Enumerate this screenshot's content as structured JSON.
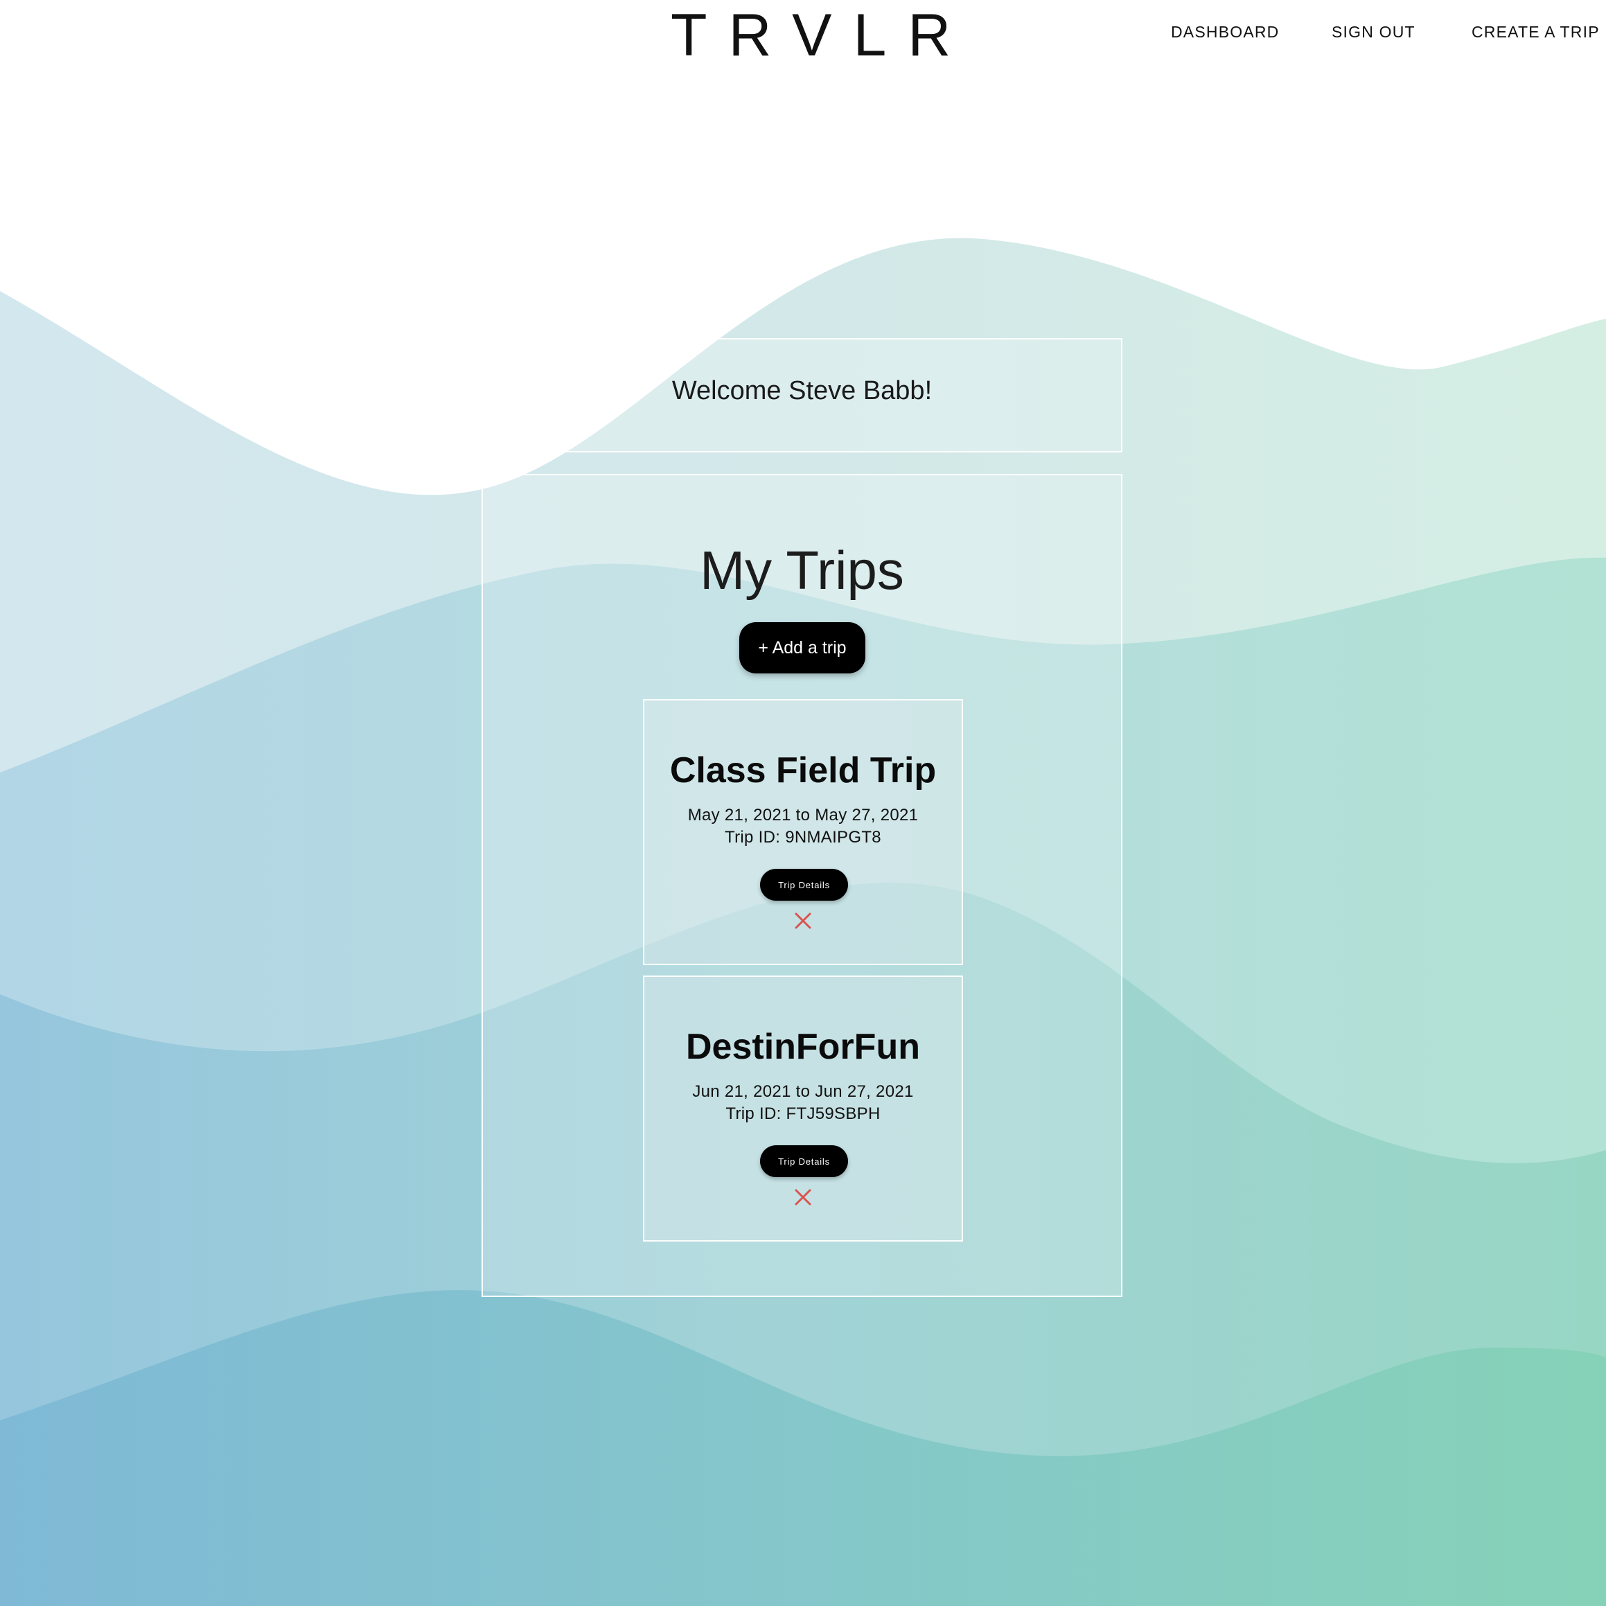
{
  "header": {
    "logo": "TRVLR",
    "nav": {
      "dashboard": "DASHBOARD",
      "sign_out": "SIGN OUT",
      "create_trip": "CREATE A TRIP"
    }
  },
  "welcome": {
    "message": "Welcome Steve Babb!"
  },
  "trips_section": {
    "title": "My Trips",
    "add_button_label": "+ Add a trip",
    "trips": [
      {
        "name": "Class Field Trip",
        "dates": "May 21, 2021 to May 27, 2021",
        "trip_id": "Trip ID: 9NMAIPGT8",
        "details_label": "Trip Details",
        "delete_icon": "close-icon"
      },
      {
        "name": "DestinForFun",
        "dates": "Jun 21, 2021 to Jun 27, 2021",
        "trip_id": "Trip ID: FTJ59SBPH",
        "details_label": "Trip Details",
        "delete_icon": "close-icon"
      }
    ]
  },
  "colors": {
    "background_top": "#ffffff",
    "wave_light": "#d2e7ea",
    "wave_mid_left": "#aed4e2",
    "wave_mid_right": "#b0e0d2",
    "wave_dark_left": "#7fb8d5",
    "wave_dark_right": "#86d0b8",
    "button": "#000000",
    "delete_icon": "#d9534f"
  }
}
